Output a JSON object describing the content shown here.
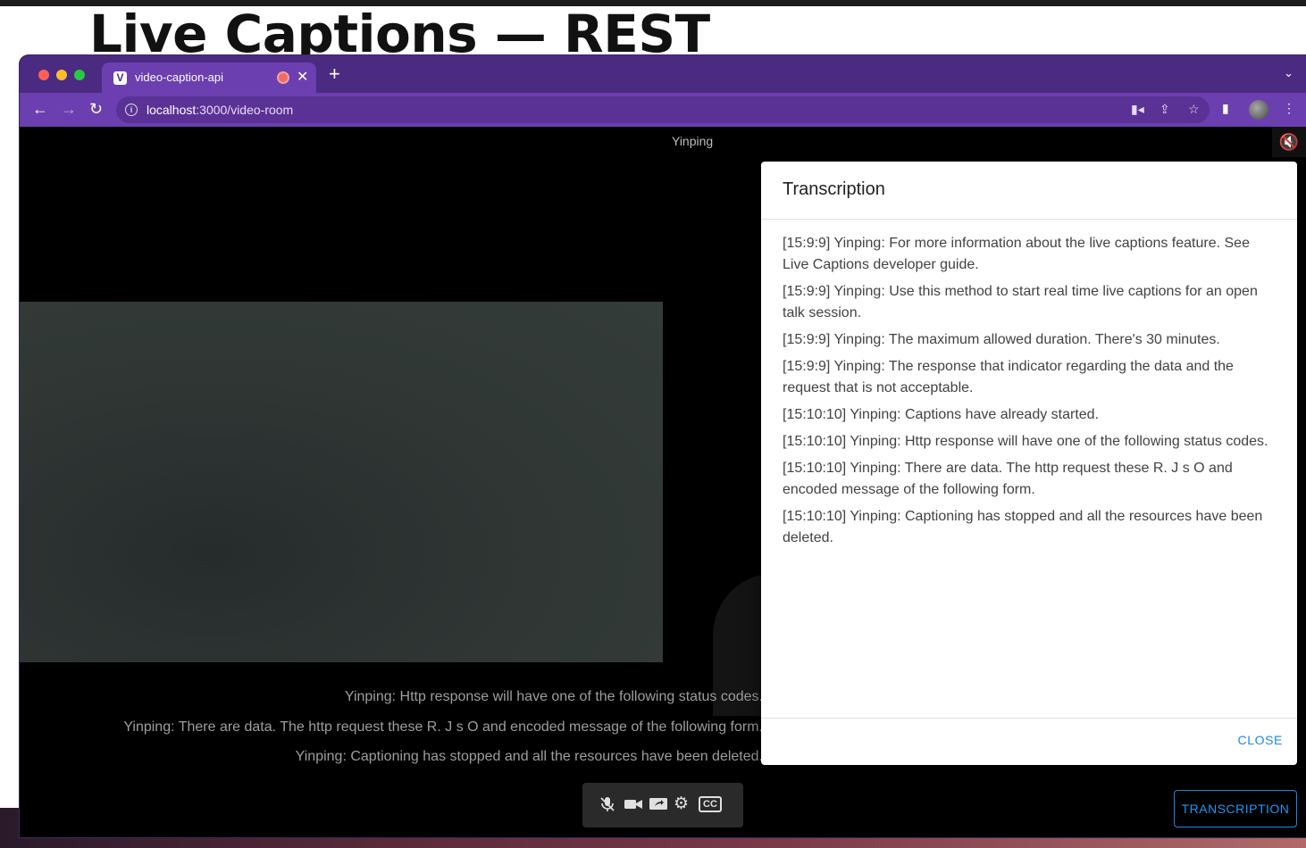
{
  "slide": {
    "title": "Live Captions — REST"
  },
  "browser": {
    "tab": {
      "title": "video-caption-api",
      "favicon": "V"
    },
    "url": {
      "host": "localhost",
      "rest": ":3000/video-room"
    }
  },
  "room": {
    "participant_name": "Yinping",
    "captions": [
      "Yinping: Http response will have one of the following status codes.",
      "Yinping: There are data. The http request these R. J s O and encoded message of the following form.",
      "Yinping: Captioning has stopped and all the resources have been deleted."
    ],
    "transcription_button": "TRANSCRIPTION"
  },
  "dialog": {
    "title": "Transcription",
    "close_label": "CLOSE",
    "entries": [
      "[15:9:9] Yinping: For more information about the live captions feature. See Live Captions developer guide.",
      "[15:9:9] Yinping: Use this method to start real time live captions for an open talk session.",
      "[15:9:9] Yinping: The maximum allowed duration. There's 30 minutes.",
      "[15:9:9] Yinping: The response that indicator regarding the data and the request that is not acceptable.",
      "[15:10:10] Yinping: Captions have already started.",
      "[15:10:10] Yinping: Http response will have one of the following status codes.",
      "[15:10:10] Yinping: There are data. The http request these R. J s O and encoded message of the following form.",
      "[15:10:10] Yinping: Captioning has stopped and all the resources have been deleted."
    ]
  },
  "icons": {
    "mic_off": "mic-off-icon",
    "camera": "camera-icon",
    "screen_share": "screen-share-icon",
    "settings": "gear-icon",
    "closed_captions": "cc-icon",
    "speaker_muted": "speaker-muted-icon"
  },
  "colors": {
    "browser_frame": "#4b2a82",
    "toolbar": "#6b3fb0",
    "accent_blue": "#1e88e5"
  }
}
